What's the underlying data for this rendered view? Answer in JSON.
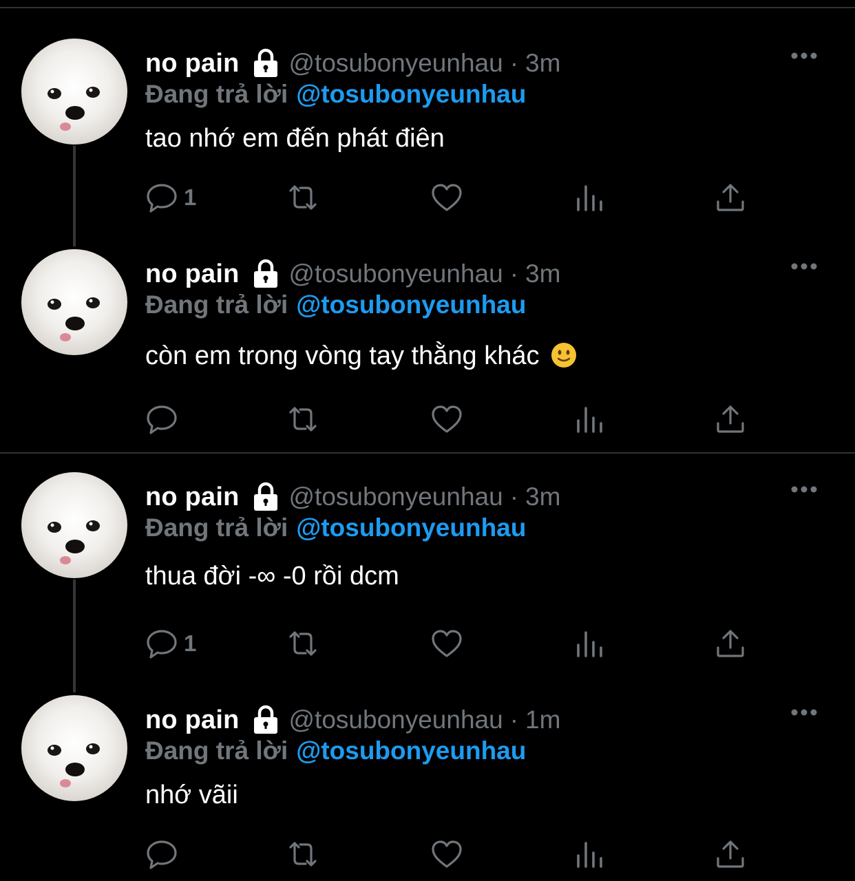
{
  "colors": {
    "background": "#000000",
    "text": "#e7e9ea",
    "muted": "#71767b",
    "link": "#1d9bf0",
    "divider": "#2f3336"
  },
  "tweets": [
    {
      "name": "no pain",
      "handle": "@tosubonyeunhau",
      "separator": "·",
      "time": "3m",
      "reply_label": "Đang trả lời",
      "reply_to": "@tosubonyeunhau",
      "text": "tao nhớ em đến phát điên",
      "reply_count": "1",
      "icons": [
        "lock-icon",
        "more-icon",
        "reply-icon",
        "retweet-icon",
        "like-icon",
        "analytics-icon",
        "share-icon"
      ]
    },
    {
      "name": "no pain",
      "handle": "@tosubonyeunhau",
      "separator": "·",
      "time": "3m",
      "reply_label": "Đang trả lời",
      "reply_to": "@tosubonyeunhau",
      "text": "còn em trong vòng tay thằng khác",
      "emoji": "slightly-smiling-face-emoji",
      "reply_count": ""
    },
    {
      "name": "no pain",
      "handle": "@tosubonyeunhau",
      "separator": "·",
      "time": "3m",
      "reply_label": "Đang trả lời",
      "reply_to": "@tosubonyeunhau",
      "text": "thua đời -∞ -0 rồi dcm",
      "reply_count": "1"
    },
    {
      "name": "no pain",
      "handle": "@tosubonyeunhau",
      "separator": "·",
      "time": "1m",
      "reply_label": "Đang trả lời",
      "reply_to": "@tosubonyeunhau",
      "text": "nhớ vãii",
      "reply_count": ""
    }
  ]
}
